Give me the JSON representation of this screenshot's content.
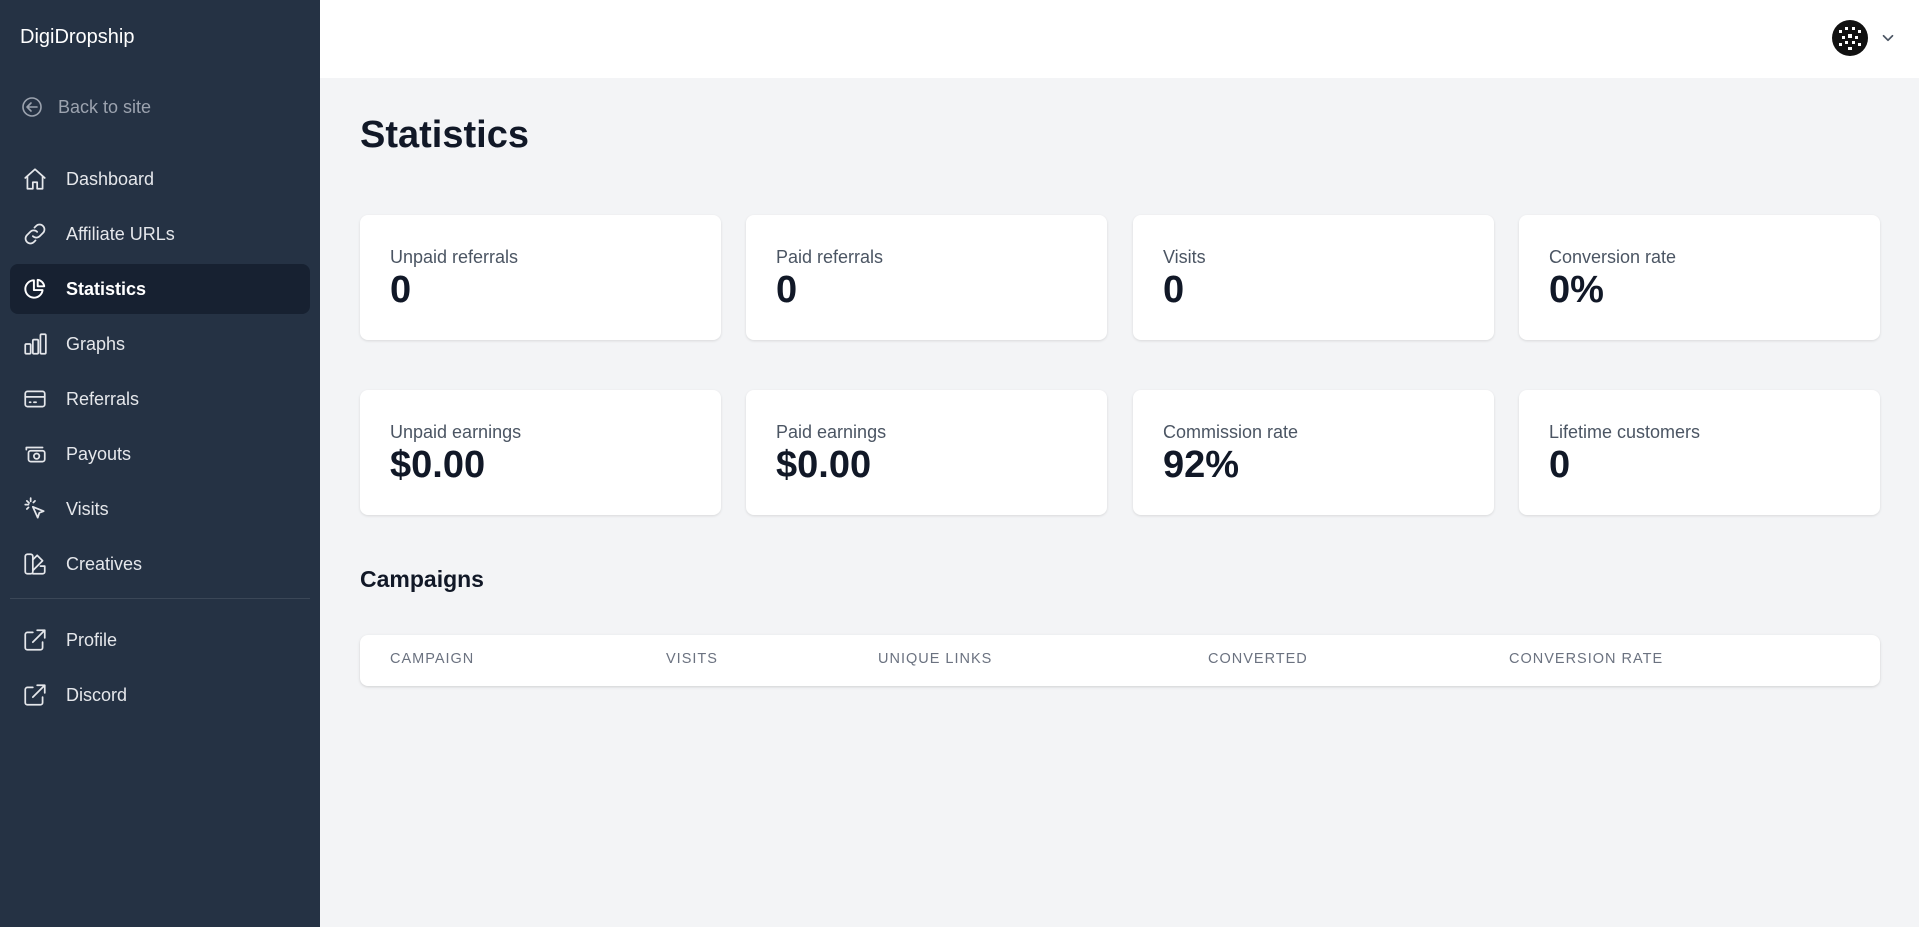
{
  "brand": "DigiDropship",
  "back_link": "Back to site",
  "nav": [
    {
      "label": "Dashboard",
      "icon": "home-icon"
    },
    {
      "label": "Affiliate URLs",
      "icon": "link-icon"
    },
    {
      "label": "Statistics",
      "icon": "chart-pie-icon",
      "active": true
    },
    {
      "label": "Graphs",
      "icon": "chart-bar-icon"
    },
    {
      "label": "Referrals",
      "icon": "credit-card-icon"
    },
    {
      "label": "Payouts",
      "icon": "cash-icon"
    },
    {
      "label": "Visits",
      "icon": "cursor-click-icon"
    },
    {
      "label": "Creatives",
      "icon": "color-swatch-icon"
    }
  ],
  "nav_secondary": [
    {
      "label": "Profile",
      "icon": "external-link-icon"
    },
    {
      "label": "Discord",
      "icon": "external-link-icon"
    }
  ],
  "page_title": "Statistics",
  "stats": [
    {
      "label": "Unpaid referrals",
      "value": "0"
    },
    {
      "label": "Paid referrals",
      "value": "0"
    },
    {
      "label": "Visits",
      "value": "0"
    },
    {
      "label": "Conversion rate",
      "value": "0%"
    },
    {
      "label": "Unpaid earnings",
      "value": "$0.00"
    },
    {
      "label": "Paid earnings",
      "value": "$0.00"
    },
    {
      "label": "Commission rate",
      "value": "92%"
    },
    {
      "label": "Lifetime customers",
      "value": "0"
    }
  ],
  "campaigns": {
    "title": "Campaigns",
    "columns": [
      "CAMPAIGN",
      "VISITS",
      "UNIQUE LINKS",
      "CONVERTED",
      "CONVERSION RATE"
    ]
  },
  "colors": {
    "sidebar_bg": "#253244",
    "sidebar_active_bg": "#172131",
    "page_bg": "#f3f4f6"
  }
}
